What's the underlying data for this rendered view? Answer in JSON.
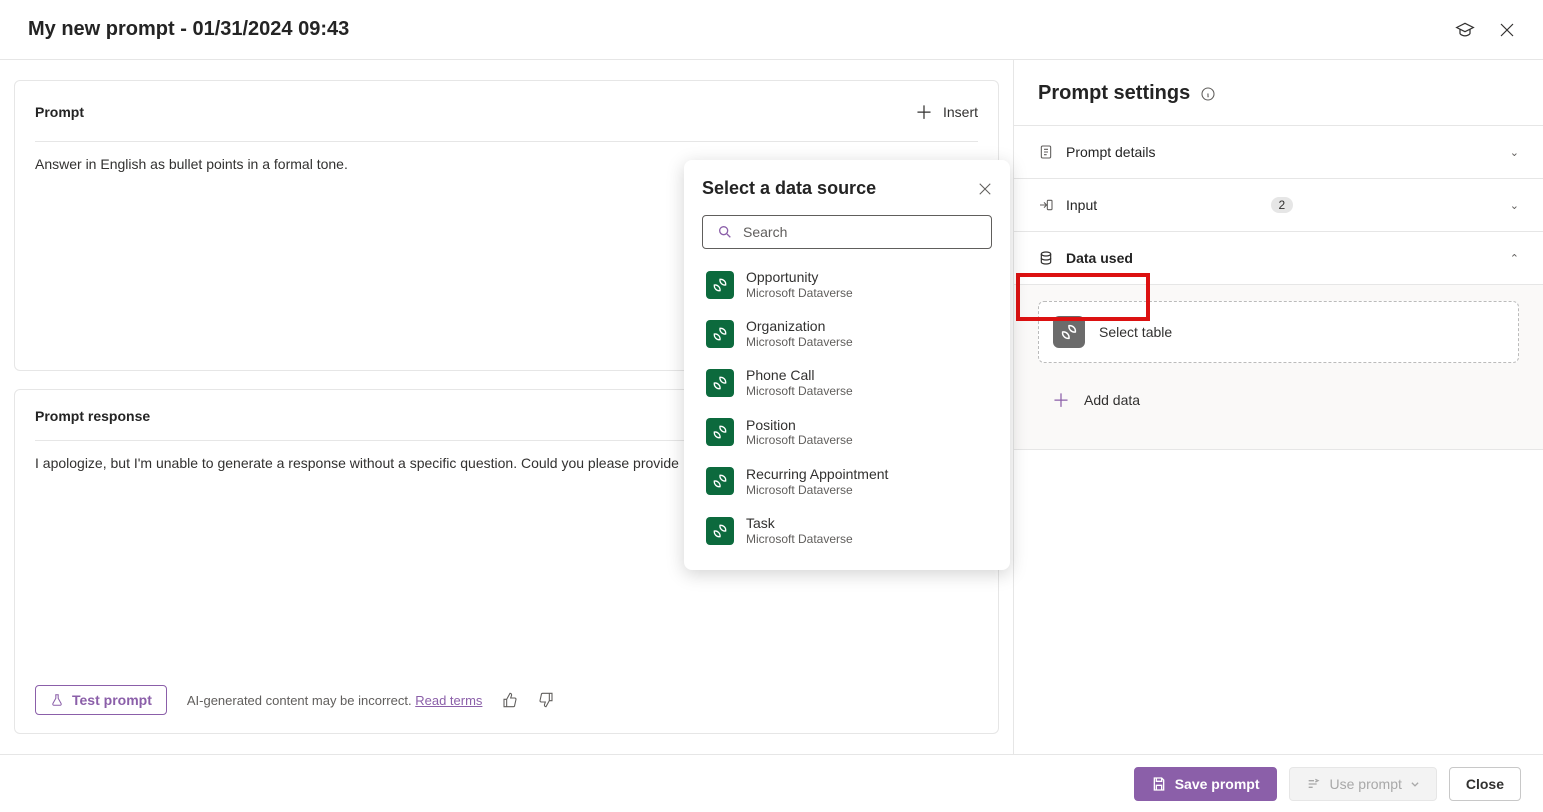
{
  "header": {
    "title": "My new prompt - 01/31/2024 09:43"
  },
  "prompt_card": {
    "title": "Prompt",
    "insert_label": "Insert",
    "text": "Answer in English as bullet points in a formal tone."
  },
  "response_card": {
    "title": "Prompt response",
    "text": "I apologize, but I'm unable to generate a response without a specific question. Could you please provide",
    "test_button": "Test prompt",
    "ai_note": "AI-generated content may be incorrect.",
    "terms_link": "Read terms"
  },
  "settings": {
    "title": "Prompt settings",
    "rows": {
      "details": "Prompt details",
      "input": "Input",
      "input_badge": "2",
      "data_used": "Data used"
    },
    "select_table": "Select table",
    "add_data": "Add data"
  },
  "popup": {
    "title": "Select a data source",
    "search_placeholder": "Search",
    "items": [
      {
        "name": "Opportunity",
        "sub": "Microsoft Dataverse"
      },
      {
        "name": "Organization",
        "sub": "Microsoft Dataverse"
      },
      {
        "name": "Phone Call",
        "sub": "Microsoft Dataverse"
      },
      {
        "name": "Position",
        "sub": "Microsoft Dataverse"
      },
      {
        "name": "Recurring Appointment",
        "sub": "Microsoft Dataverse"
      },
      {
        "name": "Task",
        "sub": "Microsoft Dataverse"
      }
    ]
  },
  "footer": {
    "save": "Save prompt",
    "use": "Use prompt",
    "close": "Close"
  }
}
